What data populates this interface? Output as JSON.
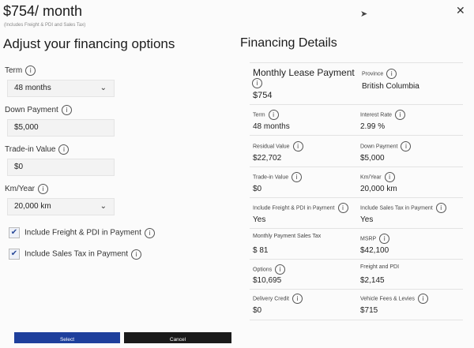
{
  "header": {
    "price": "$754/ month",
    "price_note": "(Includes Freight & PDI and Sales Tax)",
    "close_glyph": "✕"
  },
  "left": {
    "title": "Adjust your financing options",
    "term": {
      "label": "Term",
      "value": "48 months"
    },
    "down_payment": {
      "label": "Down Payment",
      "value": "$5,000"
    },
    "trade_in": {
      "label": "Trade-in Value",
      "value": "$0"
    },
    "km_year": {
      "label": "Km/Year",
      "value": "20,000 km"
    },
    "checkbox_freight": {
      "label": "Include Freight & PDI in Payment",
      "checked": true
    },
    "checkbox_sales_tax": {
      "label": "Include Sales Tax in Payment",
      "checked": true
    }
  },
  "right": {
    "title": "Financing Details",
    "monthly_lease": {
      "label": "Monthly Lease Payment",
      "value": "$754"
    },
    "province": {
      "label": "Province",
      "value": "British Columbia"
    },
    "term": {
      "label": "Term",
      "value": "48 months"
    },
    "interest": {
      "label": "Interest Rate",
      "value": "2.99 %"
    },
    "residual": {
      "label": "Residual Value",
      "value": "$22,702"
    },
    "down_payment": {
      "label": "Down Payment",
      "value": "$5,000"
    },
    "trade_in": {
      "label": "Trade-in Value",
      "value": "$0"
    },
    "km_year": {
      "label": "Km/Year",
      "value": "20,000 km"
    },
    "incl_freight": {
      "label": "Include Freight & PDI in Payment",
      "value": "Yes"
    },
    "incl_tax": {
      "label": "Include Sales Tax in Payment",
      "value": "Yes"
    },
    "monthly_tax": {
      "label": "Monthly Payment Sales Tax",
      "value": "$ 81"
    },
    "msrp": {
      "label": "MSRP",
      "value": "$42,100"
    },
    "options": {
      "label": "Options",
      "value": "$10,695"
    },
    "freight": {
      "label": "Freight and PDI",
      "value": "$2,145"
    },
    "delivery_credit": {
      "label": "Delivery Credit",
      "value": "$0"
    },
    "vehicle_fees": {
      "label": "Vehicle Fees & Levies",
      "value": "$715"
    }
  },
  "buttons": {
    "select": "Select",
    "cancel": "Cancel"
  }
}
